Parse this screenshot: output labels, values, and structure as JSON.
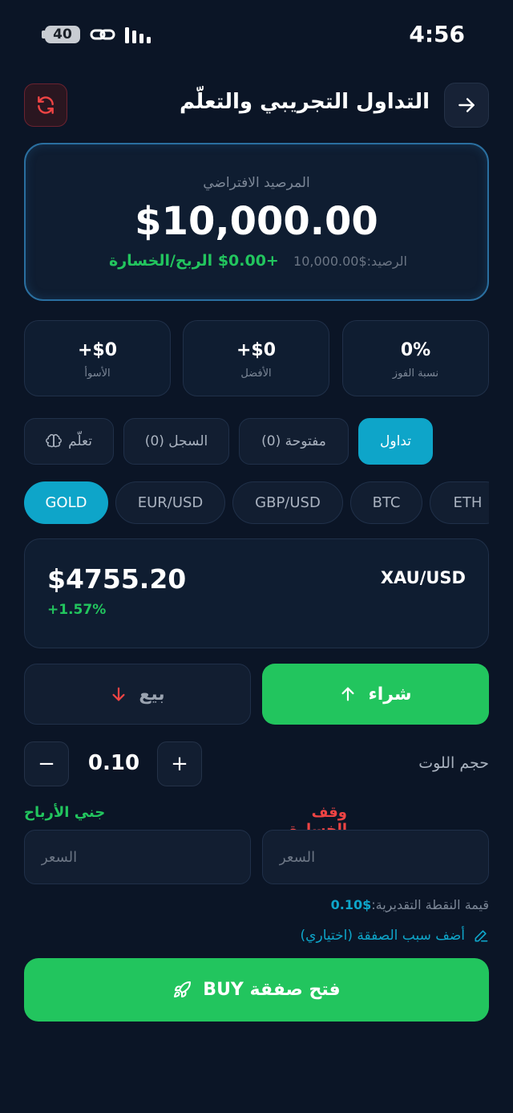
{
  "status_bar": {
    "battery": "40",
    "time": "4:56"
  },
  "header": {
    "title": "التداول التجريبي والتعلّم"
  },
  "balance": {
    "label": "المرصيد الافتراضي",
    "value": "$10,000.00",
    "sub": "الرصيد:$10,000.00",
    "pnl": "+$0.00 الربح/الخسارة"
  },
  "stats": [
    {
      "value": "0%",
      "label": "نسبة الفوز"
    },
    {
      "value": "+$0",
      "label": "الأفضل"
    },
    {
      "value": "+$0",
      "label": "الأسوأ"
    }
  ],
  "tabs": [
    {
      "label": "تداول"
    },
    {
      "label": "مفتوحة (0)"
    },
    {
      "label": "السجل (0)"
    },
    {
      "label": "تعلّم"
    }
  ],
  "assets": [
    "GOLD",
    "EUR/USD",
    "GBP/USD",
    "BTC",
    "ETH"
  ],
  "quote": {
    "price": "$4755.20",
    "change": "+1.57%",
    "symbol": "XAU/USD"
  },
  "actions": {
    "sell": "بيع",
    "buy": "شراء"
  },
  "lot": {
    "label": "حجم اللوت",
    "value": "0.10",
    "minus": "−",
    "plus": "+"
  },
  "orders": {
    "stop_loss_label": "وقف الخسارة",
    "take_profit_label": "جني الأرباح",
    "price_placeholder": "السعر"
  },
  "point_value": {
    "label": "قيمة النقطة التقديرية:",
    "value": "$0.10"
  },
  "add_reason": "أضف سبب الصفقة (اختياري)",
  "open_trade": "فتح صفقة BUY",
  "colors": {
    "background": "#0b1526",
    "accent": "#0ea5c9",
    "buy": "#22c55e",
    "sell": "#ef4444"
  }
}
